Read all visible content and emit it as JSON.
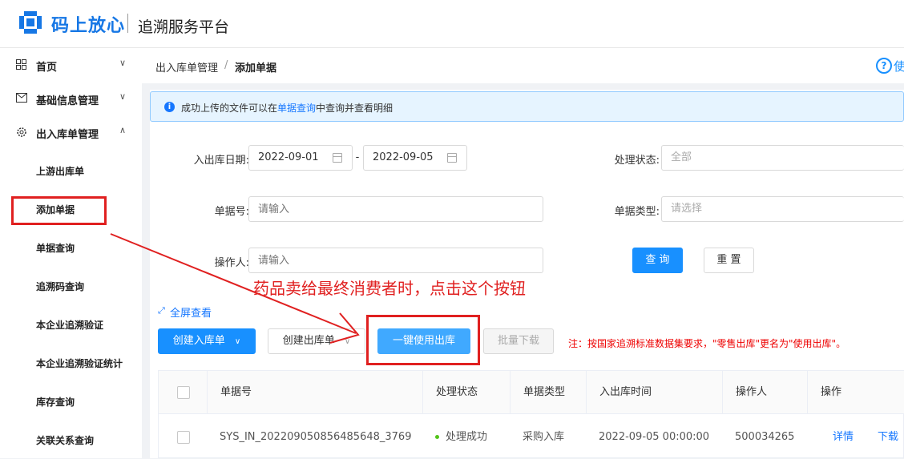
{
  "header": {
    "brand": "码上放心",
    "platform": "追溯服务平台",
    "icon": "code-cross-logo-icon"
  },
  "sidebar": {
    "items": [
      {
        "label": "首页",
        "icon": "grid-icon",
        "chevron": "∨"
      },
      {
        "label": "基础信息管理",
        "icon": "mail-icon",
        "chevron": "∨"
      },
      {
        "label": "出入库单管理",
        "icon": "gear-icon",
        "chevron": "∧"
      }
    ],
    "subitems": [
      {
        "label": "上游出库单"
      },
      {
        "label": "添加单据"
      },
      {
        "label": "单据查询"
      },
      {
        "label": "追溯码查询"
      },
      {
        "label": "本企业追溯验证"
      },
      {
        "label": "本企业追溯验证统计"
      },
      {
        "label": "库存查询"
      },
      {
        "label": "关联关系查询"
      }
    ]
  },
  "breadcrumb": {
    "parent": "出入库单管理",
    "sep": "/",
    "current": "添加单据",
    "help": "使"
  },
  "alert": {
    "before": "成功上传的文件可以在",
    "link": "单据查询",
    "after": "中查询并查看明细"
  },
  "form": {
    "date_label": "入出库日期:",
    "date_start": "2022-09-01",
    "date_dash": "-",
    "date_end": "2022-09-05",
    "status_label": "处理状态:",
    "status_value": "全部",
    "doc_no_label": "单据号:",
    "doc_no_placeholder": "请输入",
    "doc_type_label": "单据类型:",
    "doc_type_placeholder": "请选择",
    "operator_label": "操作人:",
    "operator_placeholder": "请输入",
    "query_button": "查 询",
    "reset_button": "重 置"
  },
  "toolbar": {
    "fullscreen": "全屏查看",
    "create_in": "创建入库单",
    "create_out": "创建出库单",
    "one_click": "一键使用出库",
    "batch_download": "批量下载",
    "note": "注：按国家追溯标准数据集要求，\"零售出库\"更名为\"使用出库\"。"
  },
  "table": {
    "columns": [
      "单据号",
      "处理状态",
      "单据类型",
      "入出库时间",
      "操作人",
      "操作"
    ],
    "rows": [
      {
        "doc_no": "SYS_IN_20220905085648564​8_3769",
        "status": "处理成功",
        "type": "采购入库",
        "time": "2022-09-05 00:00:00",
        "operator": "500034265",
        "action_detail": "详情",
        "action_download": "下载"
      }
    ]
  },
  "annotation": {
    "text": "药品卖给最终消费者时，点击这个按钮",
    "color": "#e02020"
  }
}
